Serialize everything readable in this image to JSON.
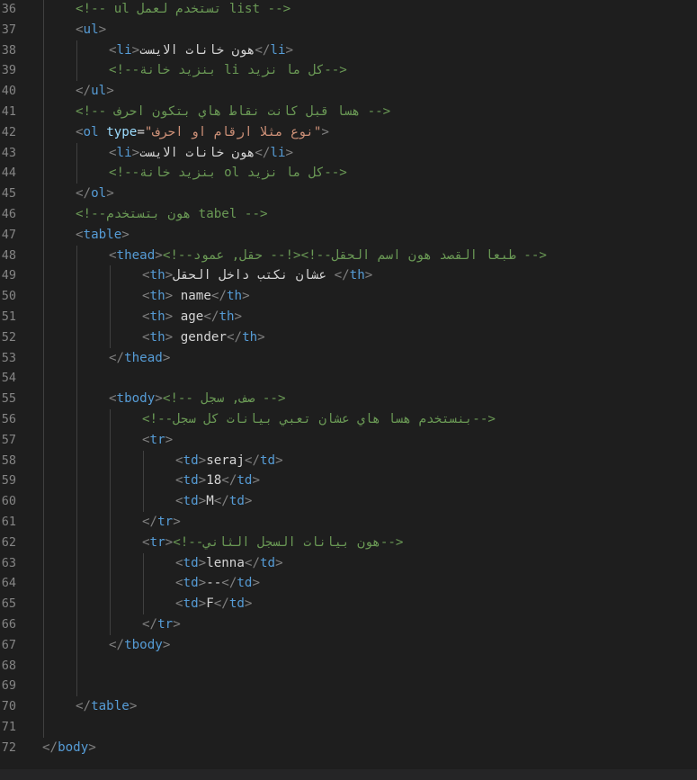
{
  "editor": {
    "language": "html",
    "colors": {
      "background": "#1e1e1e",
      "line_number": "#858585",
      "tag_bracket": "#808080",
      "tag_name": "#569cd6",
      "comment": "#6a9955",
      "text": "#d4d4d4",
      "attribute": "#9cdcfe",
      "string": "#ce9178"
    },
    "lines": [
      {
        "n": "36",
        "indent": 2,
        "tokens": [
          [
            "c",
            "<!-- ul تستخدم لعمل list -->"
          ]
        ]
      },
      {
        "n": "37",
        "indent": 2,
        "tokens": [
          [
            "t",
            "<"
          ],
          [
            "n",
            "ul"
          ],
          [
            "t",
            ">"
          ]
        ]
      },
      {
        "n": "38",
        "indent": 3,
        "tokens": [
          [
            "t",
            "<"
          ],
          [
            "n",
            "li"
          ],
          [
            "t",
            ">"
          ],
          [
            "x",
            "هون خانات الايست"
          ],
          [
            "t",
            "</"
          ],
          [
            "n",
            "li"
          ],
          [
            "t",
            ">"
          ]
        ]
      },
      {
        "n": "39",
        "indent": 3,
        "tokens": [
          [
            "c",
            "<!--بنزيد خانة li كل ما نزيد-->"
          ]
        ]
      },
      {
        "n": "40",
        "indent": 2,
        "tokens": [
          [
            "t",
            "</"
          ],
          [
            "n",
            "ul"
          ],
          [
            "t",
            ">"
          ]
        ]
      },
      {
        "n": "41",
        "indent": 2,
        "tokens": [
          [
            "c",
            "<!-- هسا قبل كانت نقاط هاي بتكون احرف -->"
          ]
        ]
      },
      {
        "n": "42",
        "indent": 2,
        "tokens": [
          [
            "t",
            "<"
          ],
          [
            "n",
            "ol"
          ],
          [
            "x",
            " "
          ],
          [
            "a",
            "type"
          ],
          [
            "x",
            "="
          ],
          [
            "s",
            "\"نوع مثلا ارقام او احرف\""
          ],
          [
            "t",
            ">"
          ]
        ]
      },
      {
        "n": "43",
        "indent": 3,
        "tokens": [
          [
            "t",
            "<"
          ],
          [
            "n",
            "li"
          ],
          [
            "t",
            ">"
          ],
          [
            "x",
            "هون خانات الايست"
          ],
          [
            "t",
            "</"
          ],
          [
            "n",
            "li"
          ],
          [
            "t",
            ">"
          ]
        ]
      },
      {
        "n": "44",
        "indent": 3,
        "tokens": [
          [
            "c",
            "<!--بنزيد خانة ol كل ما نزيد-->"
          ]
        ]
      },
      {
        "n": "45",
        "indent": 2,
        "tokens": [
          [
            "t",
            "</"
          ],
          [
            "n",
            "ol"
          ],
          [
            "t",
            ">"
          ]
        ]
      },
      {
        "n": "46",
        "indent": 2,
        "tokens": [
          [
            "c",
            "<!--هون بتستخدم tabel -->"
          ]
        ]
      },
      {
        "n": "47",
        "indent": 2,
        "tokens": [
          [
            "t",
            "<"
          ],
          [
            "n",
            "table"
          ],
          [
            "t",
            ">"
          ]
        ]
      },
      {
        "n": "48",
        "indent": 3,
        "tokens": [
          [
            "t",
            "<"
          ],
          [
            "n",
            "thead"
          ],
          [
            "t",
            ">"
          ],
          [
            "c",
            "<!--طبعا القصد هون اسم الحقل--!>"
          ],
          [
            "c",
            "<!-- حقل, عمود -->"
          ]
        ]
      },
      {
        "n": "49",
        "indent": 4,
        "tokens": [
          [
            "t",
            "<"
          ],
          [
            "n",
            "th"
          ],
          [
            "t",
            ">"
          ],
          [
            "x",
            "عشان نكتب داخل الحقل "
          ],
          [
            "t",
            "</"
          ],
          [
            "n",
            "th"
          ],
          [
            "t",
            ">"
          ]
        ]
      },
      {
        "n": "50",
        "indent": 4,
        "tokens": [
          [
            "t",
            "<"
          ],
          [
            "n",
            "th"
          ],
          [
            "t",
            ">"
          ],
          [
            "x",
            " name"
          ],
          [
            "t",
            "</"
          ],
          [
            "n",
            "th"
          ],
          [
            "t",
            ">"
          ]
        ]
      },
      {
        "n": "51",
        "indent": 4,
        "tokens": [
          [
            "t",
            "<"
          ],
          [
            "n",
            "th"
          ],
          [
            "t",
            ">"
          ],
          [
            "x",
            " age"
          ],
          [
            "t",
            "</"
          ],
          [
            "n",
            "th"
          ],
          [
            "t",
            ">"
          ]
        ]
      },
      {
        "n": "52",
        "indent": 4,
        "tokens": [
          [
            "t",
            "<"
          ],
          [
            "n",
            "th"
          ],
          [
            "t",
            ">"
          ],
          [
            "x",
            " gender"
          ],
          [
            "t",
            "</"
          ],
          [
            "n",
            "th"
          ],
          [
            "t",
            ">"
          ]
        ]
      },
      {
        "n": "53",
        "indent": 3,
        "tokens": [
          [
            "t",
            "</"
          ],
          [
            "n",
            "thead"
          ],
          [
            "t",
            ">"
          ]
        ]
      },
      {
        "n": "54",
        "indent": 0,
        "tokens": []
      },
      {
        "n": "55",
        "indent": 3,
        "tokens": [
          [
            "t",
            "<"
          ],
          [
            "n",
            "tbody"
          ],
          [
            "t",
            ">"
          ],
          [
            "c",
            "<!-- صف, سجل -->"
          ]
        ]
      },
      {
        "n": "56",
        "indent": 4,
        "tokens": [
          [
            "c",
            "<!--بنستخدم هسا هاي عشان تعبي بيانات كل سجل-->"
          ]
        ]
      },
      {
        "n": "57",
        "indent": 4,
        "tokens": [
          [
            "t",
            "<"
          ],
          [
            "n",
            "tr"
          ],
          [
            "t",
            ">"
          ]
        ]
      },
      {
        "n": "58",
        "indent": 5,
        "tokens": [
          [
            "t",
            "<"
          ],
          [
            "n",
            "td"
          ],
          [
            "t",
            ">"
          ],
          [
            "x",
            "seraj"
          ],
          [
            "t",
            "</"
          ],
          [
            "n",
            "td"
          ],
          [
            "t",
            ">"
          ]
        ]
      },
      {
        "n": "59",
        "indent": 5,
        "tokens": [
          [
            "t",
            "<"
          ],
          [
            "n",
            "td"
          ],
          [
            "t",
            ">"
          ],
          [
            "x",
            "18"
          ],
          [
            "t",
            "</"
          ],
          [
            "n",
            "td"
          ],
          [
            "t",
            ">"
          ]
        ]
      },
      {
        "n": "60",
        "indent": 5,
        "tokens": [
          [
            "t",
            "<"
          ],
          [
            "n",
            "td"
          ],
          [
            "t",
            ">"
          ],
          [
            "x",
            "M"
          ],
          [
            "t",
            "</"
          ],
          [
            "n",
            "td"
          ],
          [
            "t",
            ">"
          ]
        ]
      },
      {
        "n": "61",
        "indent": 4,
        "tokens": [
          [
            "t",
            "</"
          ],
          [
            "n",
            "tr"
          ],
          [
            "t",
            ">"
          ]
        ]
      },
      {
        "n": "62",
        "indent": 4,
        "tokens": [
          [
            "t",
            "<"
          ],
          [
            "n",
            "tr"
          ],
          [
            "t",
            ">"
          ],
          [
            "c",
            "<!--هون بيانات السجل الثاني-->"
          ]
        ]
      },
      {
        "n": "63",
        "indent": 5,
        "tokens": [
          [
            "t",
            "<"
          ],
          [
            "n",
            "td"
          ],
          [
            "t",
            ">"
          ],
          [
            "x",
            "lenna"
          ],
          [
            "t",
            "</"
          ],
          [
            "n",
            "td"
          ],
          [
            "t",
            ">"
          ]
        ]
      },
      {
        "n": "64",
        "indent": 5,
        "tokens": [
          [
            "t",
            "<"
          ],
          [
            "n",
            "td"
          ],
          [
            "t",
            ">"
          ],
          [
            "x",
            "--"
          ],
          [
            "t",
            "</"
          ],
          [
            "n",
            "td"
          ],
          [
            "t",
            ">"
          ]
        ]
      },
      {
        "n": "65",
        "indent": 5,
        "tokens": [
          [
            "t",
            "<"
          ],
          [
            "n",
            "td"
          ],
          [
            "t",
            ">"
          ],
          [
            "x",
            "F"
          ],
          [
            "t",
            "</"
          ],
          [
            "n",
            "td"
          ],
          [
            "t",
            ">"
          ]
        ]
      },
      {
        "n": "66",
        "indent": 4,
        "tokens": [
          [
            "t",
            "</"
          ],
          [
            "n",
            "tr"
          ],
          [
            "t",
            ">"
          ]
        ]
      },
      {
        "n": "67",
        "indent": 3,
        "tokens": [
          [
            "t",
            "</"
          ],
          [
            "n",
            "tbody"
          ],
          [
            "t",
            ">"
          ]
        ]
      },
      {
        "n": "68",
        "indent": 0,
        "tokens": []
      },
      {
        "n": "69",
        "indent": 0,
        "tokens": []
      },
      {
        "n": "70",
        "indent": 2,
        "tokens": [
          [
            "t",
            "</"
          ],
          [
            "n",
            "table"
          ],
          [
            "t",
            ">"
          ]
        ]
      },
      {
        "n": "71",
        "indent": 0,
        "tokens": []
      },
      {
        "n": "72",
        "indent": 1,
        "tokens": [
          [
            "t",
            "</"
          ],
          [
            "n",
            "body"
          ],
          [
            "t",
            ">"
          ]
        ]
      }
    ]
  }
}
